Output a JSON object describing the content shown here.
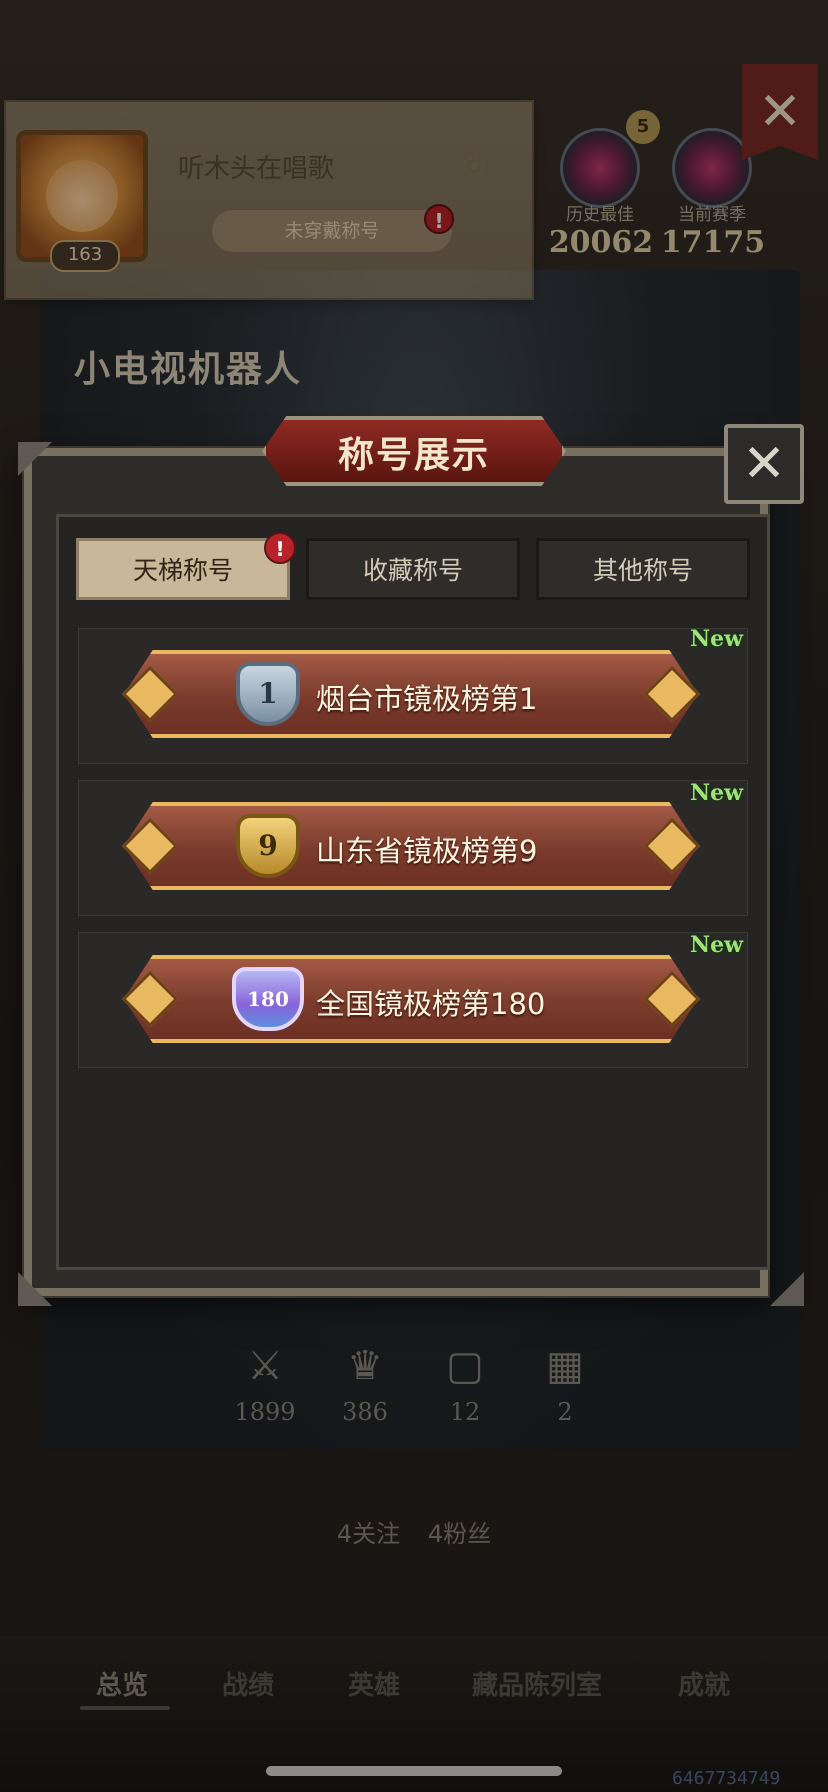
{
  "profile": {
    "player_name": "听木头在唱歌",
    "level": "163",
    "title_placeholder": "未穿戴称号",
    "alert_mark": "!"
  },
  "ranks": {
    "history_star": "5",
    "history_label": "历史最佳",
    "history_value": "20062",
    "season_label": "当前赛季",
    "season_value": "17175"
  },
  "hero_name": "小电视机器人",
  "stats": [
    {
      "icon": "crossed-swords-icon",
      "value": "1899"
    },
    {
      "icon": "crown-icon",
      "value": "386"
    },
    {
      "icon": "card-icon",
      "value": "12"
    },
    {
      "icon": "checkered-flag-icon",
      "value": "2"
    }
  ],
  "social": {
    "follow": "4关注",
    "fans": "4粉丝"
  },
  "nav": {
    "overview": "总览",
    "record": "战绩",
    "heroes": "英雄",
    "collection": "藏品陈列室",
    "achieve": "成就"
  },
  "watermark": "6467734749",
  "modal": {
    "title": "称号展示",
    "tabs": [
      "天梯称号",
      "收藏称号",
      "其他称号"
    ],
    "tab_alert": "!",
    "titles": [
      {
        "rank": "1",
        "text": "烟台市镜极榜第1",
        "new": "New"
      },
      {
        "rank": "9",
        "text": "山东省镜极榜第9",
        "new": "New"
      },
      {
        "rank": "180",
        "text": "全国镜极榜第180",
        "new": "New"
      }
    ]
  },
  "colors": {
    "banner": "#8b4535",
    "gold": "#e8b961",
    "new_tag": "#9fe27a",
    "alert": "#b8232b"
  }
}
